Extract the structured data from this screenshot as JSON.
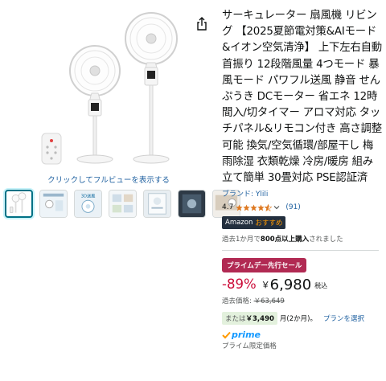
{
  "gallery": {
    "zoom_hint": "クリックしてフルビューを表示する",
    "thumbnails": [
      {
        "name": "thumb-1",
        "selected": true
      },
      {
        "name": "thumb-2",
        "selected": false
      },
      {
        "name": "thumb-3",
        "selected": false
      },
      {
        "name": "thumb-4",
        "selected": false
      },
      {
        "name": "thumb-5",
        "selected": false
      },
      {
        "name": "thumb-6",
        "selected": false
      },
      {
        "name": "thumb-7",
        "selected": false
      }
    ],
    "thumb_labels": {
      "thumb3": "3D送風"
    }
  },
  "product": {
    "title": "サーキュレーター 扇風機 リビング 【2025夏節電対策&AIモード&イオン空気清浄】 上下左右自動首振り 12段階風量 4つモード 暴風モード パワフル送風 静音 せんぷうき DCモーター 省エネ 12時間入/切タイマー アロマ対応 タッチパネル&リモコン付き 高さ調整可能 換気/空気循環/部屋干し 梅雨除湿 衣類乾燥 冷房/暖房 組み立て簡単 30畳対応 PSE認証済",
    "brand": "ブランド: Ylili",
    "rating_value": "4.7",
    "rating_stars": 4.5,
    "review_count": "(91)",
    "recommend_prefix": "Amazon",
    "recommend_suffix": "おすすめ",
    "bought_prefix": "過去1か月で",
    "bought_bold": "800点以上購入",
    "bought_suffix": "されました",
    "deal_label": "プライムデー先行セール",
    "discount": "-89%",
    "currency": "￥",
    "price": "6,980",
    "tax_label": "税込",
    "past_price_label": "過去価格: ",
    "past_price": "￥63,649",
    "installment_prefix": "または",
    "installment_amount": "￥3,490",
    "installment_term": "月(2か月)。",
    "plan_link": "プランを選択",
    "prime_word": "prime",
    "prime_only": "プライム限定価格"
  },
  "colors": {
    "link": "#2162a1",
    "deal": "#b12a53",
    "discount": "#cc0c39",
    "prime": "#1399ff",
    "star": "#de7921"
  },
  "icons": {
    "share": "share-icon",
    "star": "star-icon",
    "chevron": "chevron-down-icon",
    "prime_check": "prime-check-icon"
  }
}
